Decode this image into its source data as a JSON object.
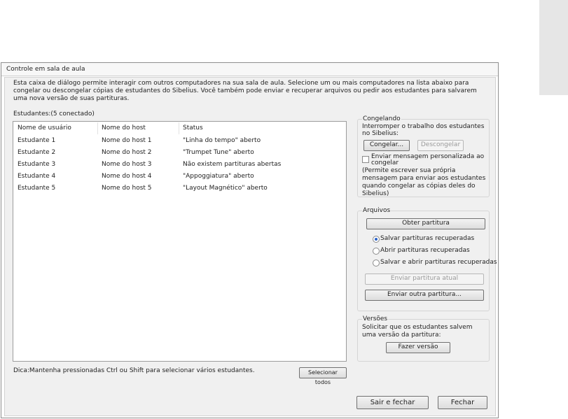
{
  "dialog": {
    "title": "Controle em sala de aula",
    "intro": "Esta caixa de diálogo permite interagir com outros computadores na sua sala de aula. Selecione um ou mais computadores na lista abaixo para congelar ou descongelar cópias de estudantes do Sibelius. Você também pode enviar e recuperar arquivos ou pedir aos estudantes para salvarem uma nova versão de suas partituras.",
    "students_label": "Estudantes:(5 conectado)",
    "columns": [
      "Nome de usuário",
      "Nome do host",
      "Status"
    ],
    "rows": [
      {
        "user": "Estudante 1",
        "host": "Nome do host 1",
        "status": "\"Linha do tempo\" aberto"
      },
      {
        "user": "Estudante 2",
        "host": "Nome do host 2",
        "status": "\"Trumpet Tune\" aberto"
      },
      {
        "user": "Estudante 3",
        "host": "Nome do host 3",
        "status": "Não existem partituras abertas"
      },
      {
        "user": "Estudante 4",
        "host": "Nome do host 4",
        "status": "\"Appoggiatura\" aberto"
      },
      {
        "user": "Estudante 5",
        "host": "Nome do host 5",
        "status": "\"Layout Magnético\" aberto"
      }
    ],
    "tip": "Dica:Mantenha pressionadas Ctrl ou Shift para selecionar vários estudantes.",
    "select_all": "Selecionar todos",
    "freeze": {
      "legend": "Congelando",
      "desc": "Interromper o trabalho dos estudantes no Sibelius:",
      "freeze_btn": "Congelar...",
      "unfreeze_btn": "Descongelar",
      "custom_msg_label": "Enviar mensagem personalizada ao congelar",
      "custom_msg_checked": false,
      "note": "(Permite escrever sua própria mensagem para enviar aos estudantes quando congelar as cópias deles do Sibelius)"
    },
    "files": {
      "legend": "Arquivos",
      "get_score_btn": "Obter partitura",
      "options": [
        "Salvar partituras recuperadas",
        "Abrir partituras recuperadas",
        "Salvar e abrir partituras recuperadas"
      ],
      "selected_option": 0,
      "send_current_btn": "Enviar partitura atual",
      "send_other_btn": "Enviar outra partitura..."
    },
    "versions": {
      "legend": "Versões",
      "desc": "Solicitar que os estudantes salvem uma versão da partitura:",
      "make_version_btn": "Fazer versão"
    },
    "exit_btn": "Sair e fechar",
    "close_btn": "Fechar"
  }
}
